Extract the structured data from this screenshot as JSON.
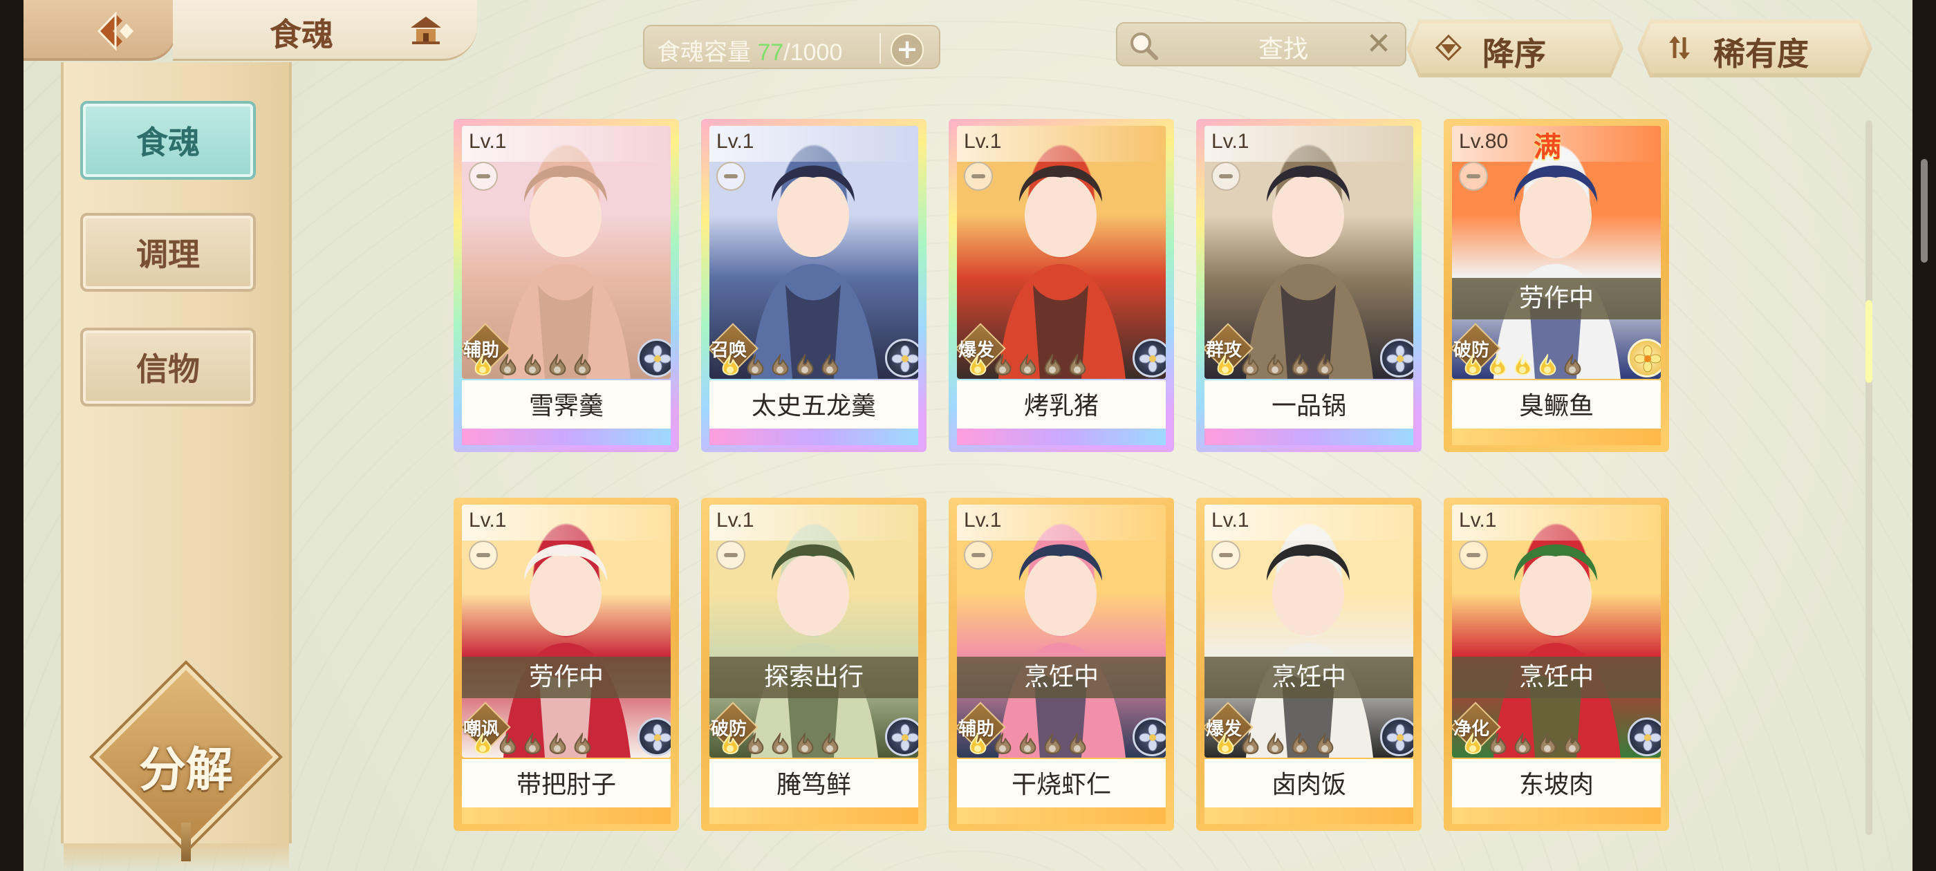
{
  "header": {
    "title": "食魂",
    "capacity_label": "食魂容量",
    "capacity_current": "77",
    "capacity_max": "/1000",
    "capacity_add": "+",
    "search_placeholder": "查找",
    "search_clear": "✕",
    "sort_order_label": "降序",
    "sort_key_label": "稀有度"
  },
  "sidebar": {
    "items": [
      {
        "label": "食魂",
        "active": true
      },
      {
        "label": "调理",
        "active": false
      },
      {
        "label": "信物",
        "active": false
      }
    ],
    "decompose_label": "分解"
  },
  "cards": [
    {
      "level": "Lv.1",
      "name": "雪霁羹",
      "role": "辅助",
      "rarity": "rainbow",
      "status": "",
      "max": "",
      "element_color": "#2a3147"
    },
    {
      "level": "Lv.1",
      "name": "太史五龙羹",
      "role": "召唤",
      "rarity": "rainbow",
      "status": "",
      "max": "",
      "element_color": "#2a3147"
    },
    {
      "level": "Lv.1",
      "name": "烤乳猪",
      "role": "爆发",
      "rarity": "rainbow",
      "status": "",
      "max": "",
      "element_color": "#2a3147"
    },
    {
      "level": "Lv.1",
      "name": "一品锅",
      "role": "群攻",
      "rarity": "rainbow",
      "status": "",
      "max": "",
      "element_color": "#2a3147"
    },
    {
      "level": "Lv.80",
      "name": "臭鳜鱼",
      "role": "破防",
      "rarity": "gold",
      "status": "劳作中",
      "max": "满",
      "element_color": "#f0c75a"
    },
    {
      "level": "Lv.1",
      "name": "带把肘子",
      "role": "嘲讽",
      "rarity": "gold",
      "status": "劳作中",
      "max": "",
      "element_color": "#2a3147"
    },
    {
      "level": "Lv.1",
      "name": "腌笃鲜",
      "role": "破防",
      "rarity": "gold",
      "status": "探索出行",
      "max": "",
      "element_color": "#2a3147"
    },
    {
      "level": "Lv.1",
      "name": "干烧虾仁",
      "role": "辅助",
      "rarity": "gold",
      "status": "烹饪中",
      "max": "",
      "element_color": "#2a3147"
    },
    {
      "level": "Lv.1",
      "name": "卤肉饭",
      "role": "爆发",
      "rarity": "gold",
      "status": "烹饪中",
      "max": "",
      "element_color": "#2a3147"
    },
    {
      "level": "Lv.1",
      "name": "东坡肉",
      "role": "净化",
      "rarity": "gold",
      "status": "烹饪中",
      "max": "",
      "element_color": "#2a3147"
    }
  ],
  "stars": {
    "card_0": 1,
    "card_1": 1,
    "card_2": 1,
    "card_3": 1,
    "card_4": 4,
    "card_5": 1,
    "card_6": 1,
    "card_7": 1,
    "card_8": 1,
    "card_9": 1
  }
}
